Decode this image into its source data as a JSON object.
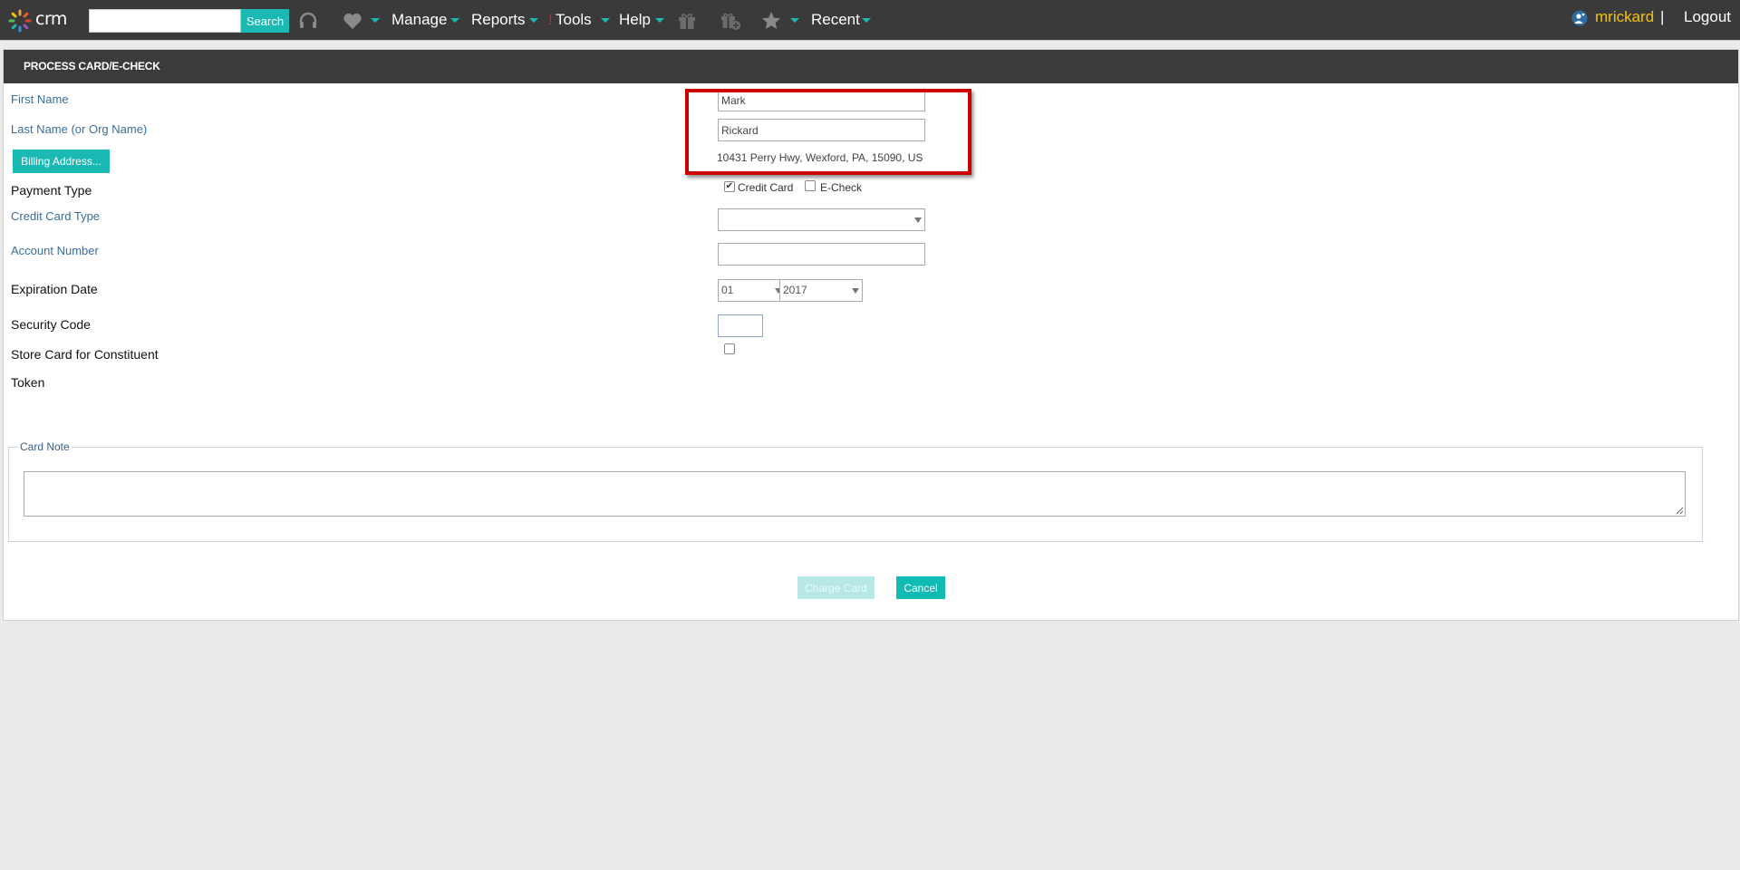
{
  "topbar": {
    "logo_text": "crm",
    "search_placeholder": "",
    "search_button": "Search",
    "nav": {
      "manage": "Manage",
      "reports": "Reports",
      "tools_mark": "!",
      "tools": "Tools",
      "help": "Help",
      "recent": "Recent"
    },
    "icons": [
      "headset-icon",
      "heart-icon",
      "gift-icon",
      "gift-add-icon",
      "star-icon"
    ],
    "user": "mrickard",
    "separator": "|",
    "logout": "Logout"
  },
  "form": {
    "title": "PROCESS CARD/E-CHECK",
    "first_name_label": "First Name",
    "first_name_value": "Mark",
    "last_name_label": "Last Name (or Org Name)",
    "last_name_value": "Rickard",
    "billing_button": "Billing Address...",
    "address": "10431 Perry Hwy, Wexford, PA, 15090, US",
    "payment_type_label": "Payment Type",
    "credit_card_option": "Credit Card",
    "credit_card_checked": true,
    "echeck_option": "E-Check",
    "echeck_checked": false,
    "card_type_label": "Credit Card Type",
    "card_type_value": "",
    "account_number_label": "Account Number",
    "account_number_value": "",
    "expiration_label": "Expiration Date",
    "exp_month": "01",
    "exp_year": "2017",
    "security_code_label": "Security Code",
    "store_card_label": "Store Card for Constituent",
    "store_card_checked": false,
    "token_label": "Token",
    "card_note_legend": "Card Note",
    "card_note_value": "",
    "charge_button": "Charge Card",
    "cancel_button": "Cancel"
  },
  "colors": {
    "topbar": "#3a3a3a",
    "accent": "#1bb9b4",
    "highlight": "#cc0000",
    "user": "#f5c400"
  }
}
